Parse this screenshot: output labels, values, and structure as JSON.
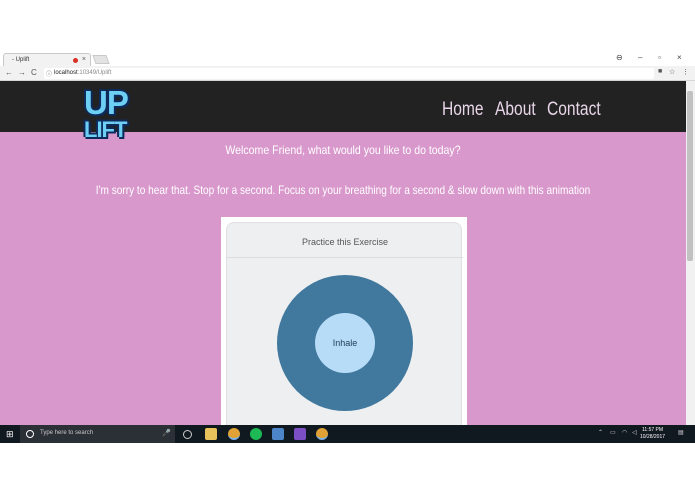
{
  "browser": {
    "tab_title": "- Uplift",
    "tab_close": "×",
    "address_host": "localhost",
    "address_path": ":10349/Uplift",
    "back": "←",
    "forward": "→",
    "reload": "C",
    "info": "ⓘ"
  },
  "site": {
    "logo_top": "UP",
    "logo_bottom": "LIFT",
    "nav": [
      "Home",
      "About",
      "Contact"
    ],
    "welcome": "Welcome Friend, what would you like to do today?",
    "message": "I'm sorry to hear that. Stop for a second. Focus on your breathing for a second & slow down with this animation",
    "card_title": "Practice this Exercise",
    "breath_label": "Inhale"
  },
  "taskbar": {
    "search_placeholder": "Type here to search",
    "time": "11:57 PM",
    "date": "10/28/2017"
  },
  "colors": {
    "page_bg": "#d898cc",
    "header_bg": "#222222",
    "circle_outer": "#41789d",
    "circle_inner": "#b6dcf8"
  }
}
